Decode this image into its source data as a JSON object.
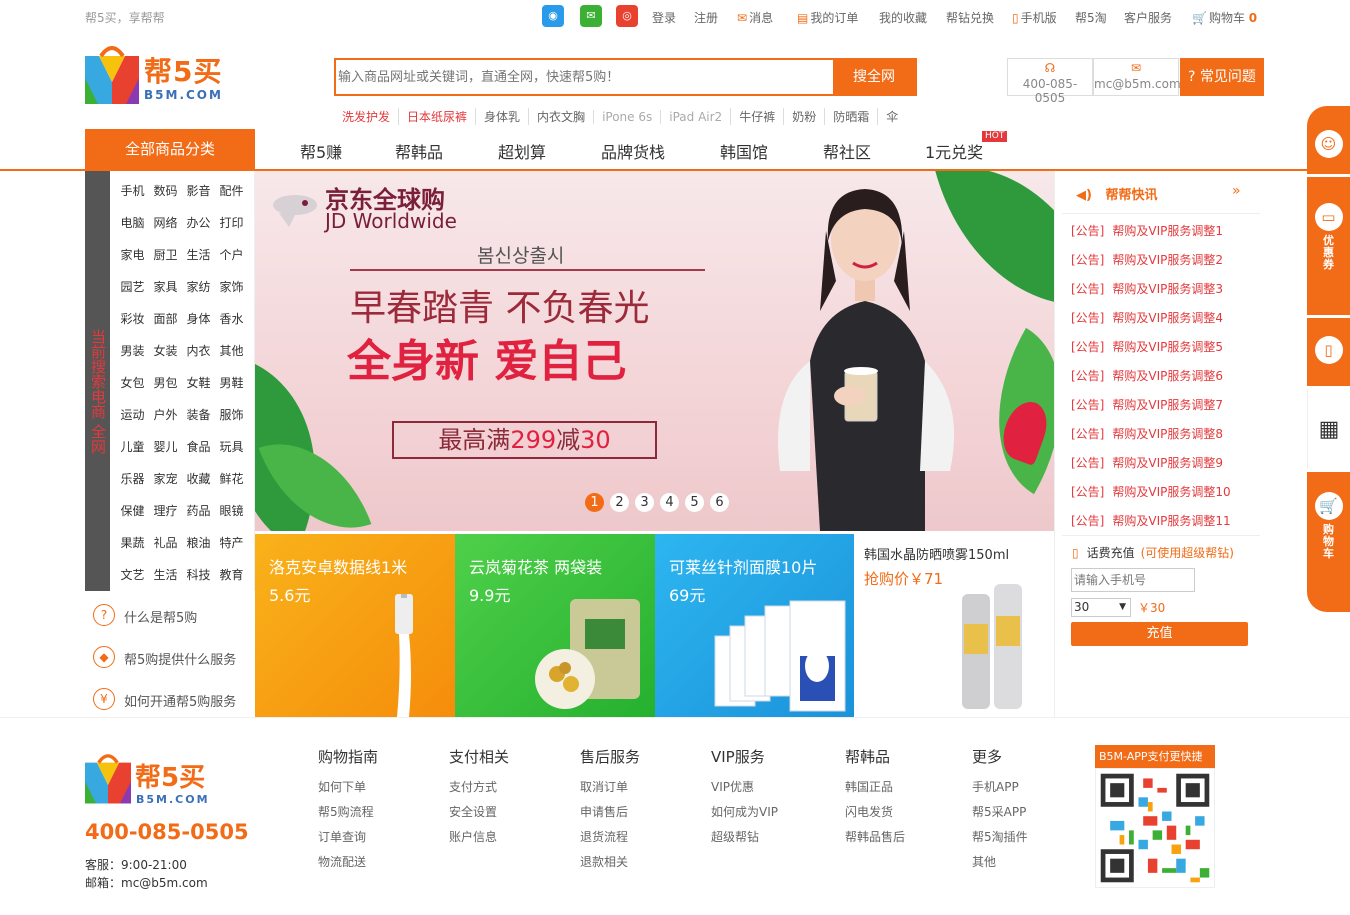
{
  "topbar": {
    "slogan": "帮5买，享帮帮",
    "social_icons": [
      "qq-icon",
      "wechat-icon",
      "weibo-icon"
    ],
    "links": {
      "login": "登录",
      "register": "注册",
      "messages": "消息",
      "orders": "我的订单",
      "favorites": "我的收藏",
      "diamond": "帮钻兑换",
      "mobile": "手机版",
      "b5tao": "帮5淘",
      "service": "客户服务",
      "cart": "购物车",
      "cart_count": "0"
    }
  },
  "header": {
    "logo_text": "帮5买",
    "logo_sub": "B5M.COM",
    "search_placeholder": "输入商品网址或关键词，直通全网，快速帮5购！",
    "search_button": "搜全网",
    "hot_words": [
      "洗发护发",
      "日本纸尿裤",
      "身体乳",
      "内衣文胸",
      "iPone 6s",
      "iPad Air2",
      "牛仔裤",
      "奶粉",
      "防晒霜",
      "伞"
    ],
    "phone": "400-085-0505",
    "email": "mc@b5m.com",
    "faq": "常见问题"
  },
  "nav": {
    "all_categories": "全部商品分类",
    "items": [
      "帮5赚",
      "帮韩品",
      "超划算",
      "品牌货栈",
      "韩国馆",
      "帮社区",
      "1元兑奖"
    ],
    "hot_badge": "HOT"
  },
  "categories": {
    "vertical_label": "当前搜索电商 全网",
    "rows": [
      [
        "手机",
        "数码",
        "影音",
        "配件"
      ],
      [
        "电脑",
        "网络",
        "办公",
        "打印"
      ],
      [
        "家电",
        "厨卫",
        "生活",
        "个户"
      ],
      [
        "园艺",
        "家具",
        "家纺",
        "家饰"
      ],
      [
        "彩妆",
        "面部",
        "身体",
        "香水"
      ],
      [
        "男装",
        "女装",
        "内衣",
        "其他"
      ],
      [
        "女包",
        "男包",
        "女鞋",
        "男鞋"
      ],
      [
        "运动",
        "户外",
        "装备",
        "服饰"
      ],
      [
        "儿童",
        "婴儿",
        "食品",
        "玩具"
      ],
      [
        "乐器",
        "家宠",
        "收藏",
        "鲜花"
      ],
      [
        "保健",
        "理疗",
        "药品",
        "眼镜"
      ],
      [
        "果蔬",
        "礼品",
        "粮油",
        "特产"
      ],
      [
        "文艺",
        "生活",
        "科技",
        "教育"
      ]
    ],
    "help": [
      "什么是帮5购",
      "帮5购提供什么服务",
      "如何开通帮5购服务"
    ]
  },
  "banner": {
    "brand_cn": "京东全球购",
    "brand_en": "JD Worldwide",
    "korean": "봄신상출시",
    "headline1": "早春踏青 不负春光",
    "headline2": "全身新 爱自己",
    "promo_prefix": "最高满",
    "promo_red": "299",
    "promo_mid": "减",
    "promo_red2": "30",
    "pages": [
      "1",
      "2",
      "3",
      "4",
      "5",
      "6"
    ],
    "active_page": "1"
  },
  "tiles": [
    {
      "title": "洛克安卓数据线1米",
      "price": "5.6元",
      "color": "#f7a20e"
    },
    {
      "title": "云岚菊花茶 两袋装",
      "price": "9.9元",
      "color": "#39c23a"
    },
    {
      "title": "可莱丝针剂面膜10片",
      "price": "69元",
      "color": "#1fa3e6"
    },
    {
      "title": "韩国水晶防晒喷雾150ml",
      "price": "抢购价￥71"
    }
  ],
  "news": {
    "title": "帮帮快讯",
    "more": "»",
    "items": [
      {
        "tag": "[公告]",
        "text": "帮购及VIP服务调整1"
      },
      {
        "tag": "[公告]",
        "text": "帮购及VIP服务调整2"
      },
      {
        "tag": "[公告]",
        "text": "帮购及VIP服务调整3"
      },
      {
        "tag": "[公告]",
        "text": "帮购及VIP服务调整4"
      },
      {
        "tag": "[公告]",
        "text": "帮购及VIP服务调整5"
      },
      {
        "tag": "[公告]",
        "text": "帮购及VIP服务调整6"
      },
      {
        "tag": "[公告]",
        "text": "帮购及VIP服务调整7"
      },
      {
        "tag": "[公告]",
        "text": "帮购及VIP服务调整8"
      },
      {
        "tag": "[公告]",
        "text": "帮购及VIP服务调整9"
      },
      {
        "tag": "[公告]",
        "text": "帮购及VIP服务调整10"
      },
      {
        "tag": "[公告]",
        "text": "帮购及VIP服务调整11"
      }
    ]
  },
  "recharge": {
    "title": "话费充值",
    "note": "(可使用超级帮钻)",
    "placeholder": "请输入手机号",
    "amount": "30",
    "price": "￥30",
    "button": "充值"
  },
  "sidebar_right": {
    "coupon": "优惠券",
    "cart": "购物车"
  },
  "footer": {
    "logo_text": "帮5买",
    "logo_sub": "B5M.COM",
    "phone": "400-085-0505",
    "hours": "客服：9:00-21:00",
    "email": "邮箱：mc@b5m.com",
    "columns": [
      {
        "title": "购物指南",
        "links": [
          "如何下单",
          "帮5购流程",
          "订单查询",
          "物流配送"
        ]
      },
      {
        "title": "支付相关",
        "links": [
          "支付方式",
          "安全设置",
          "账户信息"
        ]
      },
      {
        "title": "售后服务",
        "links": [
          "取消订单",
          "申请售后",
          "退货流程",
          "退款相关"
        ]
      },
      {
        "title": "VIP服务",
        "links": [
          "VIP优惠",
          "如何成为VIP",
          "超级帮钻"
        ]
      },
      {
        "title": "帮韩品",
        "links": [
          "韩国正品",
          "闪电发货",
          "帮韩品售后"
        ]
      },
      {
        "title": "更多",
        "links": [
          "手机APP",
          "帮5采APP",
          "帮5淘插件",
          "其他"
        ]
      }
    ],
    "qr_title": "B5M-APP支付更快捷"
  }
}
